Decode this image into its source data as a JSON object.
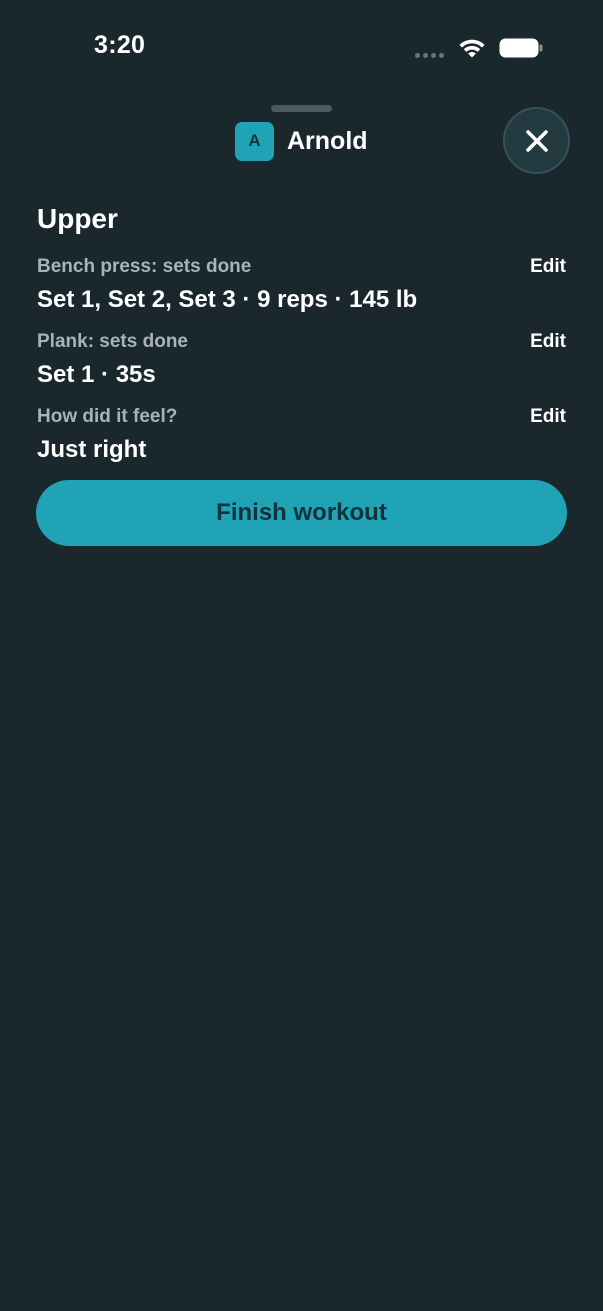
{
  "status_bar": {
    "time": "3:20"
  },
  "header": {
    "avatar_letter": "A",
    "user_name": "Arnold",
    "close_icon": "close-icon"
  },
  "workout": {
    "title": "Upper",
    "rows": [
      {
        "label": "Bench press: sets done",
        "value": "Set 1, Set 2, Set 3 · 9 reps · 145 lb",
        "edit_label": "Edit"
      },
      {
        "label": "Plank: sets done",
        "value": "Set 1 · 35s",
        "edit_label": "Edit"
      },
      {
        "label": "How did it feel?",
        "value": "Just right",
        "edit_label": "Edit"
      }
    ],
    "finish_label": "Finish workout"
  },
  "colors": {
    "background": "#1a282e",
    "accent": "#21a3b6",
    "muted_text": "#a8b3b7"
  }
}
